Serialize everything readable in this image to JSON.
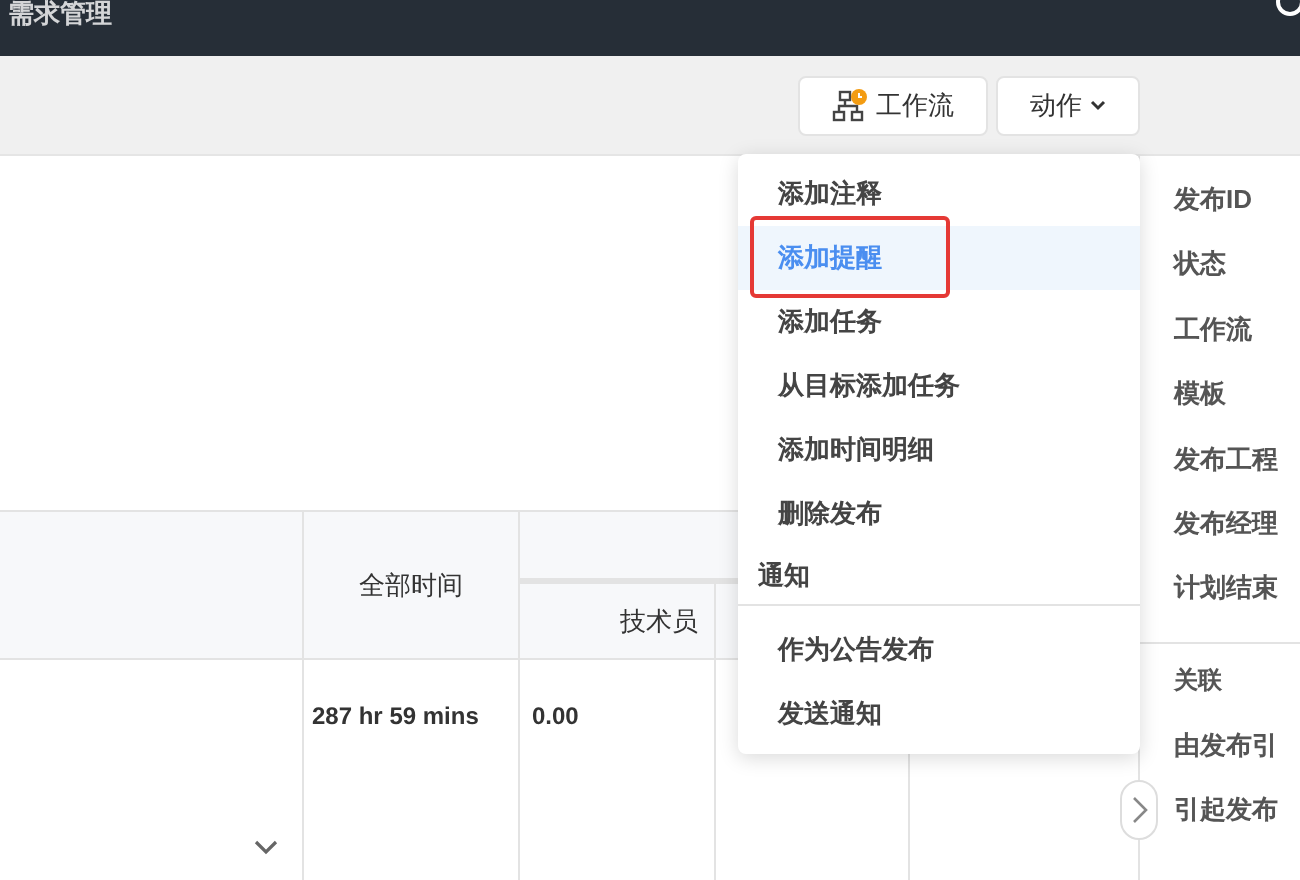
{
  "header": {
    "title": "需求管理"
  },
  "toolbar": {
    "buttons": [
      {
        "kind": "workflow",
        "label": "工作流"
      },
      {
        "kind": "dropdown",
        "label": "动作"
      }
    ]
  },
  "table": {
    "columns": [
      {
        "label": "全部时间"
      }
    ],
    "subcolumns": [
      {
        "label": "技术员"
      }
    ],
    "rows": [
      {
        "total": "287 hr 59 mins",
        "column_3": "0.00"
      }
    ]
  },
  "details_panel": {
    "fields": [
      "发布ID",
      "状态",
      "工作流",
      "模板",
      "发布工程",
      "发布经理",
      "计划结束"
    ],
    "section": "关联",
    "links": [
      "由发布引",
      "引起发布"
    ]
  },
  "actions_menu": {
    "items": [
      {
        "kind": "item",
        "label": "添加注释",
        "selected": false,
        "outlined": false
      },
      {
        "kind": "item",
        "label": "添加提醒",
        "selected": true,
        "outlined": true
      },
      {
        "kind": "item",
        "label": "添加任务",
        "selected": false,
        "outlined": false
      },
      {
        "kind": "item",
        "label": "从目标添加任务",
        "selected": false,
        "outlined": false
      },
      {
        "kind": "item",
        "label": "添加时间明细",
        "selected": false,
        "outlined": false
      },
      {
        "kind": "item",
        "label": "删除发布",
        "selected": false,
        "outlined": false
      },
      {
        "kind": "section",
        "label": "通知"
      },
      {
        "kind": "item",
        "label": "作为公告发布",
        "selected": false,
        "outlined": false
      },
      {
        "kind": "item",
        "label": "发送通知",
        "selected": false,
        "outlined": false
      }
    ]
  }
}
